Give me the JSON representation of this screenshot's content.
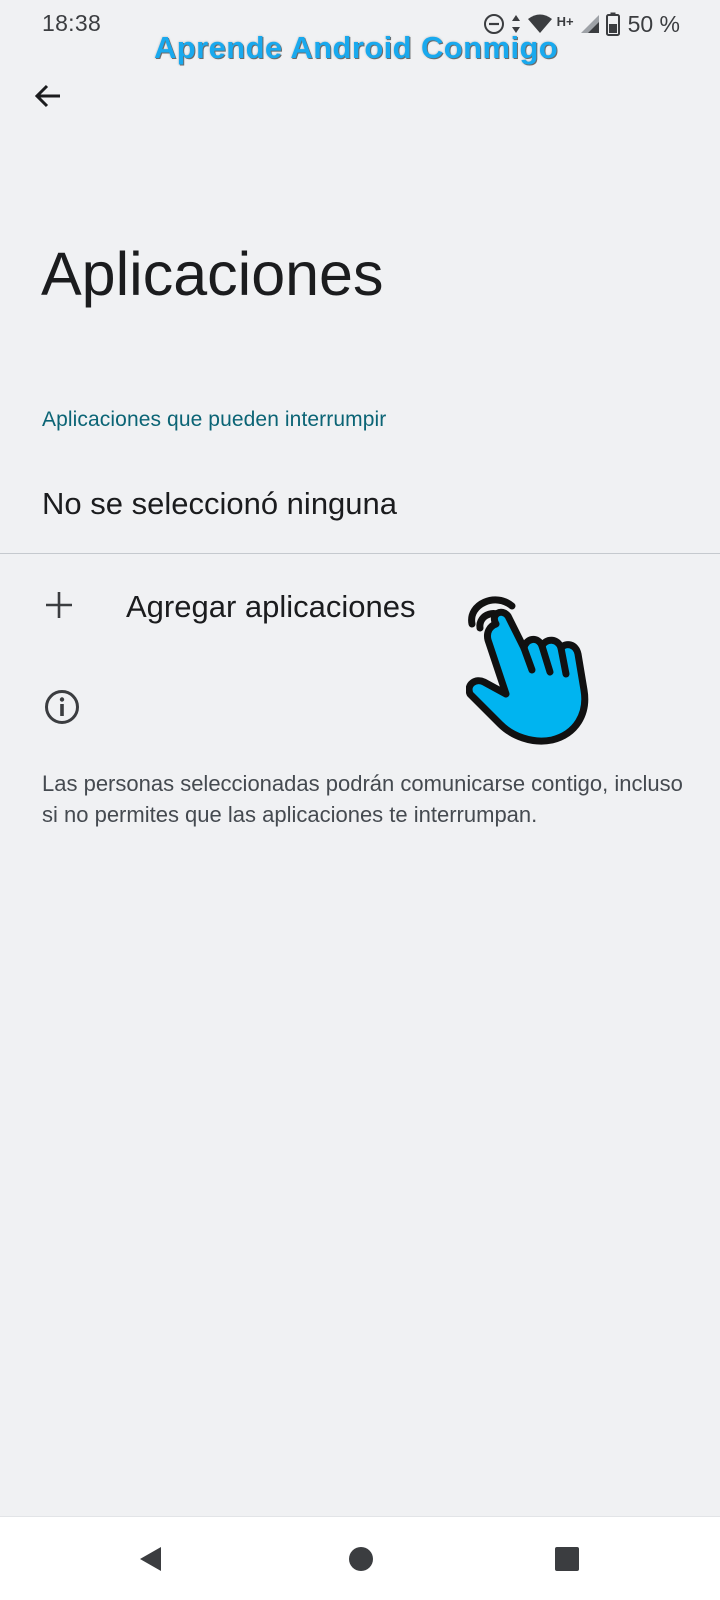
{
  "status_bar": {
    "time": "18:38",
    "network": "H+",
    "battery": "50 %",
    "icons": [
      "do-not-disturb-icon",
      "data-arrows-icon",
      "wifi-icon",
      "signal-icon",
      "battery-icon"
    ]
  },
  "watermark": "Aprende Android Conmigo",
  "header": {
    "back_icon": "arrow-back-icon"
  },
  "page_title": "Aplicaciones",
  "section": {
    "header": "Aplicaciones que pueden interrumpir",
    "selected_value": "No se seleccionó ninguna"
  },
  "add_apps": {
    "icon": "plus-icon",
    "label": "Agregar aplicaciones"
  },
  "info": {
    "icon": "info-icon",
    "text": "Las personas seleccionadas podrán comunicarse contigo, incluso si no permites que las aplicaciones te interrumpan."
  },
  "nav_bar": {
    "buttons": [
      "nav-back-icon",
      "nav-home-icon",
      "nav-recents-icon"
    ]
  },
  "colors": {
    "background": "#f0f1f3",
    "accent": "#0b6475",
    "watermark": "#19a9ee",
    "pointer_hand": "#00b4f0"
  }
}
